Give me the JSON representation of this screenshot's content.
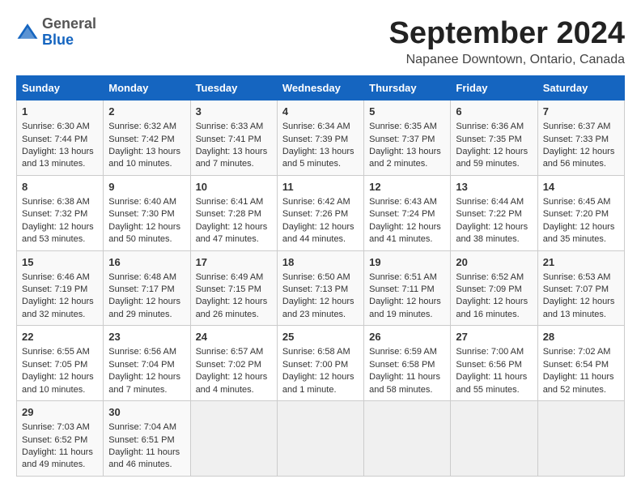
{
  "header": {
    "logo_general": "General",
    "logo_blue": "Blue",
    "month_title": "September 2024",
    "location": "Napanee Downtown, Ontario, Canada"
  },
  "days_of_week": [
    "Sunday",
    "Monday",
    "Tuesday",
    "Wednesday",
    "Thursday",
    "Friday",
    "Saturday"
  ],
  "weeks": [
    [
      {
        "day": 1,
        "sunrise": "Sunrise: 6:30 AM",
        "sunset": "Sunset: 7:44 PM",
        "daylight": "Daylight: 13 hours and 13 minutes."
      },
      {
        "day": 2,
        "sunrise": "Sunrise: 6:32 AM",
        "sunset": "Sunset: 7:42 PM",
        "daylight": "Daylight: 13 hours and 10 minutes."
      },
      {
        "day": 3,
        "sunrise": "Sunrise: 6:33 AM",
        "sunset": "Sunset: 7:41 PM",
        "daylight": "Daylight: 13 hours and 7 minutes."
      },
      {
        "day": 4,
        "sunrise": "Sunrise: 6:34 AM",
        "sunset": "Sunset: 7:39 PM",
        "daylight": "Daylight: 13 hours and 5 minutes."
      },
      {
        "day": 5,
        "sunrise": "Sunrise: 6:35 AM",
        "sunset": "Sunset: 7:37 PM",
        "daylight": "Daylight: 13 hours and 2 minutes."
      },
      {
        "day": 6,
        "sunrise": "Sunrise: 6:36 AM",
        "sunset": "Sunset: 7:35 PM",
        "daylight": "Daylight: 12 hours and 59 minutes."
      },
      {
        "day": 7,
        "sunrise": "Sunrise: 6:37 AM",
        "sunset": "Sunset: 7:33 PM",
        "daylight": "Daylight: 12 hours and 56 minutes."
      }
    ],
    [
      {
        "day": 8,
        "sunrise": "Sunrise: 6:38 AM",
        "sunset": "Sunset: 7:32 PM",
        "daylight": "Daylight: 12 hours and 53 minutes."
      },
      {
        "day": 9,
        "sunrise": "Sunrise: 6:40 AM",
        "sunset": "Sunset: 7:30 PM",
        "daylight": "Daylight: 12 hours and 50 minutes."
      },
      {
        "day": 10,
        "sunrise": "Sunrise: 6:41 AM",
        "sunset": "Sunset: 7:28 PM",
        "daylight": "Daylight: 12 hours and 47 minutes."
      },
      {
        "day": 11,
        "sunrise": "Sunrise: 6:42 AM",
        "sunset": "Sunset: 7:26 PM",
        "daylight": "Daylight: 12 hours and 44 minutes."
      },
      {
        "day": 12,
        "sunrise": "Sunrise: 6:43 AM",
        "sunset": "Sunset: 7:24 PM",
        "daylight": "Daylight: 12 hours and 41 minutes."
      },
      {
        "day": 13,
        "sunrise": "Sunrise: 6:44 AM",
        "sunset": "Sunset: 7:22 PM",
        "daylight": "Daylight: 12 hours and 38 minutes."
      },
      {
        "day": 14,
        "sunrise": "Sunrise: 6:45 AM",
        "sunset": "Sunset: 7:20 PM",
        "daylight": "Daylight: 12 hours and 35 minutes."
      }
    ],
    [
      {
        "day": 15,
        "sunrise": "Sunrise: 6:46 AM",
        "sunset": "Sunset: 7:19 PM",
        "daylight": "Daylight: 12 hours and 32 minutes."
      },
      {
        "day": 16,
        "sunrise": "Sunrise: 6:48 AM",
        "sunset": "Sunset: 7:17 PM",
        "daylight": "Daylight: 12 hours and 29 minutes."
      },
      {
        "day": 17,
        "sunrise": "Sunrise: 6:49 AM",
        "sunset": "Sunset: 7:15 PM",
        "daylight": "Daylight: 12 hours and 26 minutes."
      },
      {
        "day": 18,
        "sunrise": "Sunrise: 6:50 AM",
        "sunset": "Sunset: 7:13 PM",
        "daylight": "Daylight: 12 hours and 23 minutes."
      },
      {
        "day": 19,
        "sunrise": "Sunrise: 6:51 AM",
        "sunset": "Sunset: 7:11 PM",
        "daylight": "Daylight: 12 hours and 19 minutes."
      },
      {
        "day": 20,
        "sunrise": "Sunrise: 6:52 AM",
        "sunset": "Sunset: 7:09 PM",
        "daylight": "Daylight: 12 hours and 16 minutes."
      },
      {
        "day": 21,
        "sunrise": "Sunrise: 6:53 AM",
        "sunset": "Sunset: 7:07 PM",
        "daylight": "Daylight: 12 hours and 13 minutes."
      }
    ],
    [
      {
        "day": 22,
        "sunrise": "Sunrise: 6:55 AM",
        "sunset": "Sunset: 7:05 PM",
        "daylight": "Daylight: 12 hours and 10 minutes."
      },
      {
        "day": 23,
        "sunrise": "Sunrise: 6:56 AM",
        "sunset": "Sunset: 7:04 PM",
        "daylight": "Daylight: 12 hours and 7 minutes."
      },
      {
        "day": 24,
        "sunrise": "Sunrise: 6:57 AM",
        "sunset": "Sunset: 7:02 PM",
        "daylight": "Daylight: 12 hours and 4 minutes."
      },
      {
        "day": 25,
        "sunrise": "Sunrise: 6:58 AM",
        "sunset": "Sunset: 7:00 PM",
        "daylight": "Daylight: 12 hours and 1 minute."
      },
      {
        "day": 26,
        "sunrise": "Sunrise: 6:59 AM",
        "sunset": "Sunset: 6:58 PM",
        "daylight": "Daylight: 11 hours and 58 minutes."
      },
      {
        "day": 27,
        "sunrise": "Sunrise: 7:00 AM",
        "sunset": "Sunset: 6:56 PM",
        "daylight": "Daylight: 11 hours and 55 minutes."
      },
      {
        "day": 28,
        "sunrise": "Sunrise: 7:02 AM",
        "sunset": "Sunset: 6:54 PM",
        "daylight": "Daylight: 11 hours and 52 minutes."
      }
    ],
    [
      {
        "day": 29,
        "sunrise": "Sunrise: 7:03 AM",
        "sunset": "Sunset: 6:52 PM",
        "daylight": "Daylight: 11 hours and 49 minutes."
      },
      {
        "day": 30,
        "sunrise": "Sunrise: 7:04 AM",
        "sunset": "Sunset: 6:51 PM",
        "daylight": "Daylight: 11 hours and 46 minutes."
      },
      null,
      null,
      null,
      null,
      null
    ]
  ]
}
